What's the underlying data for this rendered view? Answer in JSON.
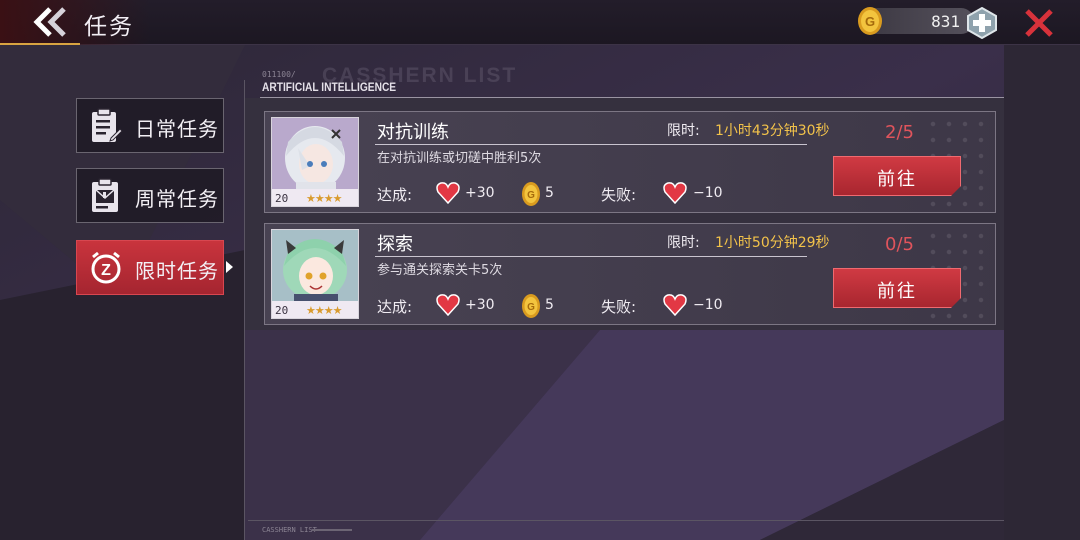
{
  "header": {
    "title": "任务",
    "currency_amount": "831"
  },
  "menu": {
    "items": [
      {
        "label": "日常任务",
        "icon": "clipboard-icon",
        "active": false
      },
      {
        "label": "周常任务",
        "icon": "mail-clipboard-icon",
        "active": false
      },
      {
        "label": "限时任务",
        "icon": "z-alarm-icon",
        "active": true
      }
    ]
  },
  "panel": {
    "code": "011100/",
    "ghost_title": "CASSHERN LIST",
    "heading": "ARTIFICIAL INTELLIGENCE",
    "footer_label": "CASSHERN LIST"
  },
  "tasks": [
    {
      "name": "对抗训练",
      "description": "在对抗训练或切磋中胜利5次",
      "time_label": "限时:",
      "time_value": "1小时43分钟30秒",
      "progress": "2/5",
      "button_label": "前往",
      "level": "20",
      "stars": "★★★★",
      "success_label": "达成:",
      "success_hearts": "+30",
      "success_coins": "5",
      "fail_label": "失败:",
      "fail_hearts": "−10"
    },
    {
      "name": "探索",
      "description": "参与通关探索关卡5次",
      "time_label": "限时:",
      "time_value": "1小时50分钟29秒",
      "progress": "0/5",
      "button_label": "前往",
      "level": "20",
      "stars": "★★★★",
      "success_label": "达成:",
      "success_hearts": "+30",
      "success_coins": "5",
      "fail_label": "失败:",
      "fail_hearts": "−10"
    }
  ],
  "colors": {
    "accent_red": "#c9343d",
    "time_gold": "#f2c24a",
    "progress_red": "#e0545c"
  }
}
